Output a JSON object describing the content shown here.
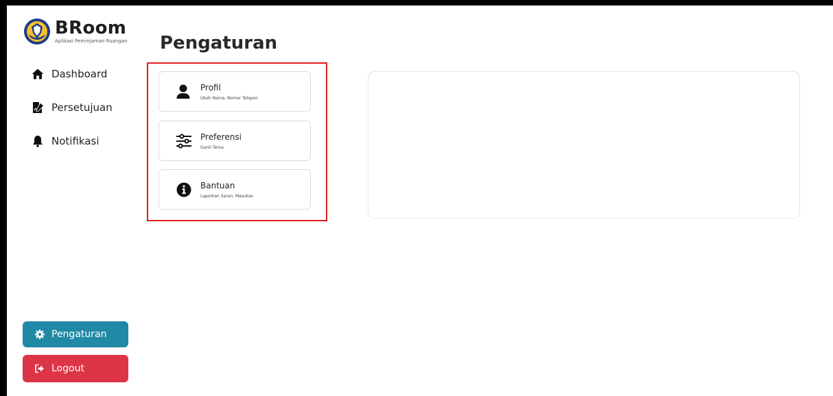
{
  "brand": {
    "title": "BRoom",
    "subtitle": "Aplikasi Peminjaman Ruangan",
    "logo_icon": "shield-logo-icon"
  },
  "sidebar": {
    "items": [
      {
        "label": "Dashboard",
        "icon": "home-icon"
      },
      {
        "label": "Persetujuan",
        "icon": "signature-icon"
      },
      {
        "label": "Notifikasi",
        "icon": "bell-icon"
      }
    ],
    "settings_button": "Pengaturan",
    "logout_button": "Logout"
  },
  "page": {
    "title": "Pengaturan"
  },
  "settings_menu": [
    {
      "title": "Profil",
      "subtitle": "Ubah Nama, Nomor Telepon",
      "icon": "user-icon"
    },
    {
      "title": "Preferensi",
      "subtitle": "Ganti Tema",
      "icon": "sliders-icon"
    },
    {
      "title": "Bantuan",
      "subtitle": "Laporkan Saran, Masukan",
      "icon": "info-icon"
    }
  ],
  "colors": {
    "settings_button": "#2089a6",
    "logout_button": "#dc3545",
    "highlight": "#e01b1b"
  }
}
